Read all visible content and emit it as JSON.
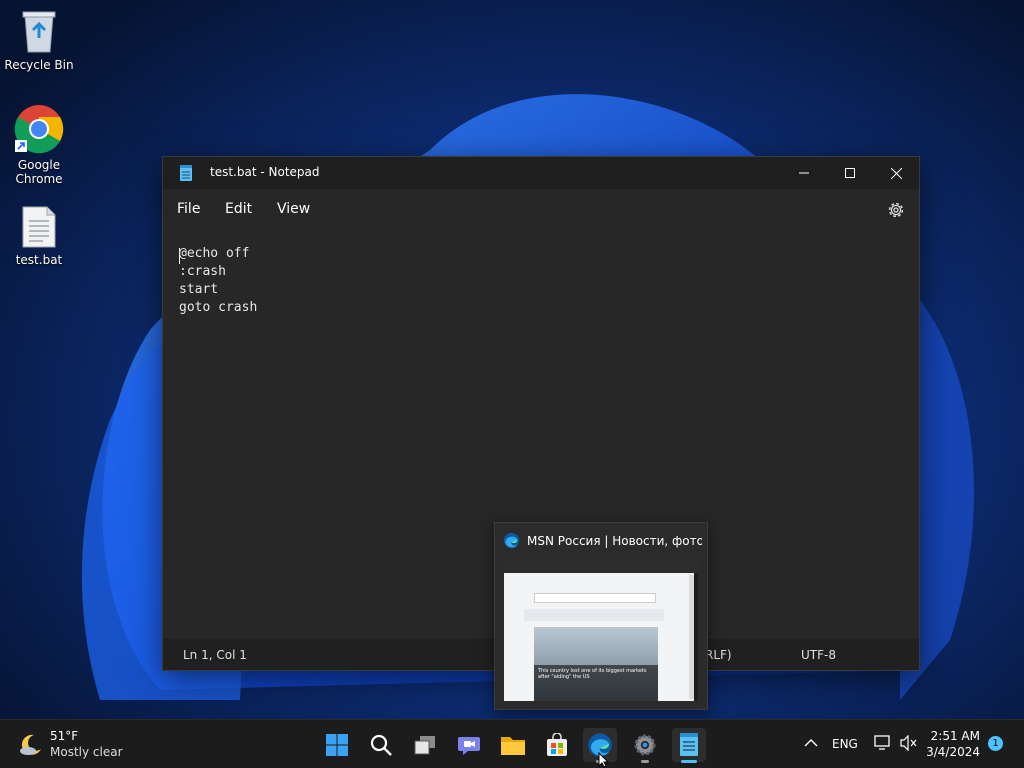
{
  "desktop": {
    "icons": [
      {
        "label": "Recycle Bin"
      },
      {
        "label": "Google Chrome"
      },
      {
        "label": "test.bat"
      }
    ]
  },
  "notepad": {
    "title": "test.bat - Notepad",
    "menu": {
      "file": "File",
      "edit": "Edit",
      "view": "View"
    },
    "lines": [
      "@echo off",
      ":crash",
      "start",
      "goto crash"
    ],
    "status": {
      "position": "Ln 1, Col 1",
      "line_ending": "RLF)",
      "encoding": "UTF-8"
    }
  },
  "preview": {
    "title": "MSN Россия | Новости, фото,...",
    "headline": "This country lost one of its biggest markets after \"aiding\" the US"
  },
  "taskbar": {
    "weather": {
      "temp": "51°F",
      "condition": "Mostly clear"
    },
    "language": "ENG",
    "time": "2:51 AM",
    "date": "3/4/2024",
    "notifications": "1"
  },
  "colors": {
    "accent": "#0078d4",
    "edge": "#30a9ef"
  }
}
